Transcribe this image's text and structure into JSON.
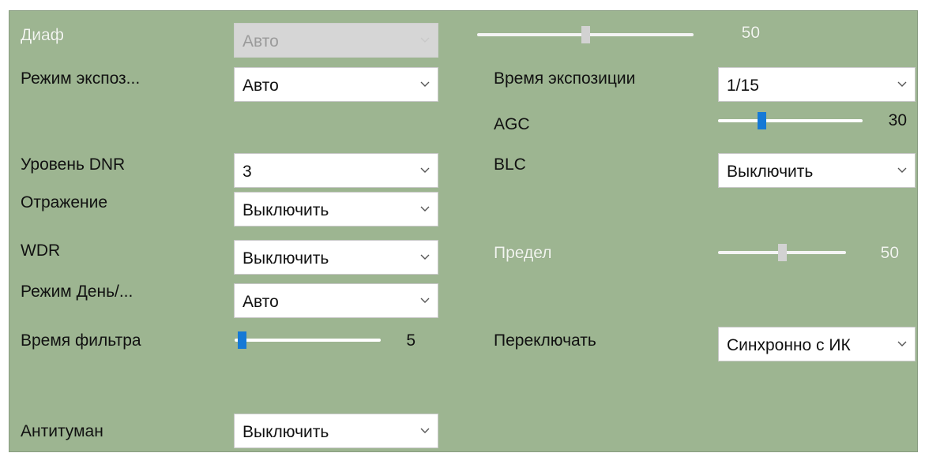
{
  "left": {
    "iris": {
      "label": "Диаф",
      "value": "Авто"
    },
    "exposure_mode": {
      "label": "Режим экспоз...",
      "value": "Авто"
    },
    "dnr_level": {
      "label": "Уровень DNR",
      "value": "3"
    },
    "mirror": {
      "label": "Отражение",
      "value": "Выключить"
    },
    "wdr": {
      "label": "WDR",
      "value": "Выключить"
    },
    "day_night": {
      "label": "Режим День/...",
      "value": "Авто"
    },
    "filter_time": {
      "label": "Время фильтра",
      "value": "5",
      "level_fraction": 0.05
    },
    "defog": {
      "label": "Антитуман",
      "value": "Выключить"
    }
  },
  "right": {
    "iris_level": {
      "value": "50",
      "level_fraction": 0.5
    },
    "exposure_time": {
      "label": "Время экспозиции",
      "value": "1/15"
    },
    "agc": {
      "label": "AGC",
      "value": "30",
      "level_fraction": 0.3
    },
    "blc": {
      "label": "BLC",
      "value": "Выключить"
    },
    "limit": {
      "label": "Предел",
      "value": "50",
      "level_fraction": 0.5
    },
    "switch": {
      "label": "Переключать",
      "value": "Синхронно с ИК"
    }
  },
  "colors": {
    "panel_bg": "#9db591",
    "slider_thumb": "#1579d6",
    "disabled_text": "#f2f6ef"
  },
  "icons": {
    "dropdown": "chevron-down-icon"
  }
}
